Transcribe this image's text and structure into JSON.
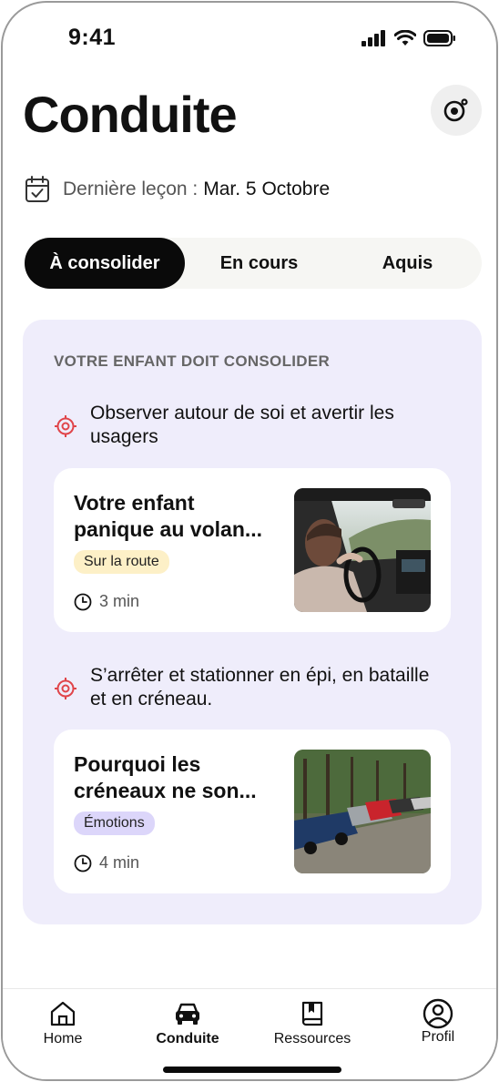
{
  "status_bar": {
    "time": "9:41"
  },
  "header": {
    "title": "Conduite",
    "settings_icon": "settings-user-icon"
  },
  "last_lesson": {
    "label": "Dernière leçon :",
    "value": "Mar. 5 Octobre"
  },
  "tabs": [
    {
      "label": "À consolider",
      "active": true
    },
    {
      "label": "En cours",
      "active": false
    },
    {
      "label": "Aquis",
      "active": false
    }
  ],
  "panel": {
    "heading": "VOTRE ENFANT DOIT CONSOLIDER",
    "skills": [
      {
        "text": "Observer autour de soi et avertir les usagers",
        "card": {
          "title": "Votre enfant panique au volan...",
          "badge": "Sur la route",
          "duration": "3 min"
        }
      },
      {
        "text": "S’arrêter et stationner en épi, en bataille et en créneau.",
        "card": {
          "title": "Pourquoi les créneaux ne son...",
          "badge": "Émotions",
          "duration": "4 min"
        }
      }
    ]
  },
  "nav": [
    {
      "label": "Home",
      "icon": "home-icon",
      "active": false
    },
    {
      "label": "Conduite",
      "icon": "car-icon",
      "active": true
    },
    {
      "label": "Ressources",
      "icon": "book-icon",
      "active": false
    },
    {
      "label": "Profil",
      "icon": "profile-icon",
      "active": false
    }
  ],
  "colors": {
    "accent_dark": "#0a0a0a",
    "panel_bg": "#efedfb",
    "target_red": "#e0454a",
    "badge_road": "#fdf0c7",
    "badge_emotion": "#dcd6fa"
  }
}
